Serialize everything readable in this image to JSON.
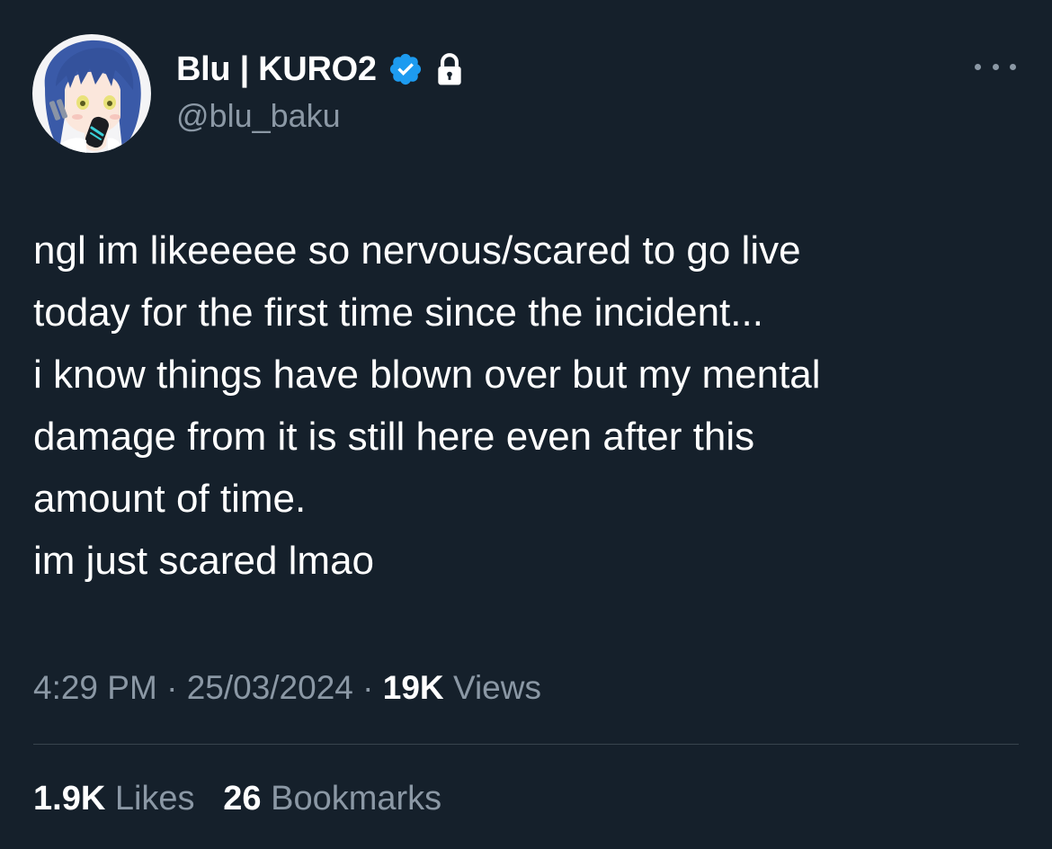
{
  "author": {
    "display_name": "Blu | KURO2",
    "handle": "@blu_baku",
    "verified_icon": "verified-badge-icon",
    "protected_icon": "lock-icon",
    "avatar": "avatar-image",
    "badge_color": "#1d9bf0"
  },
  "menu": {
    "icon": "more-horizontal-icon"
  },
  "tweet": {
    "lines": [
      "ngl im likeeeee so nervous/scared to go live",
      "today for the first time since the incident...",
      "i know things have blown over but my mental",
      "damage from it is still here even after this",
      "amount of time.",
      "im just scared lmao"
    ]
  },
  "meta": {
    "time": "4:29 PM",
    "separator": "·",
    "date": "25/03/2024",
    "views_count": "19K",
    "views_label": "Views"
  },
  "stats": {
    "likes_count": "1.9K",
    "likes_label": "Likes",
    "bookmarks_count": "26",
    "bookmarks_label": "Bookmarks"
  },
  "colors": {
    "background": "#15202b",
    "text_primary": "#ffffff",
    "text_secondary": "#8b98a5",
    "divider": "#38444d"
  }
}
